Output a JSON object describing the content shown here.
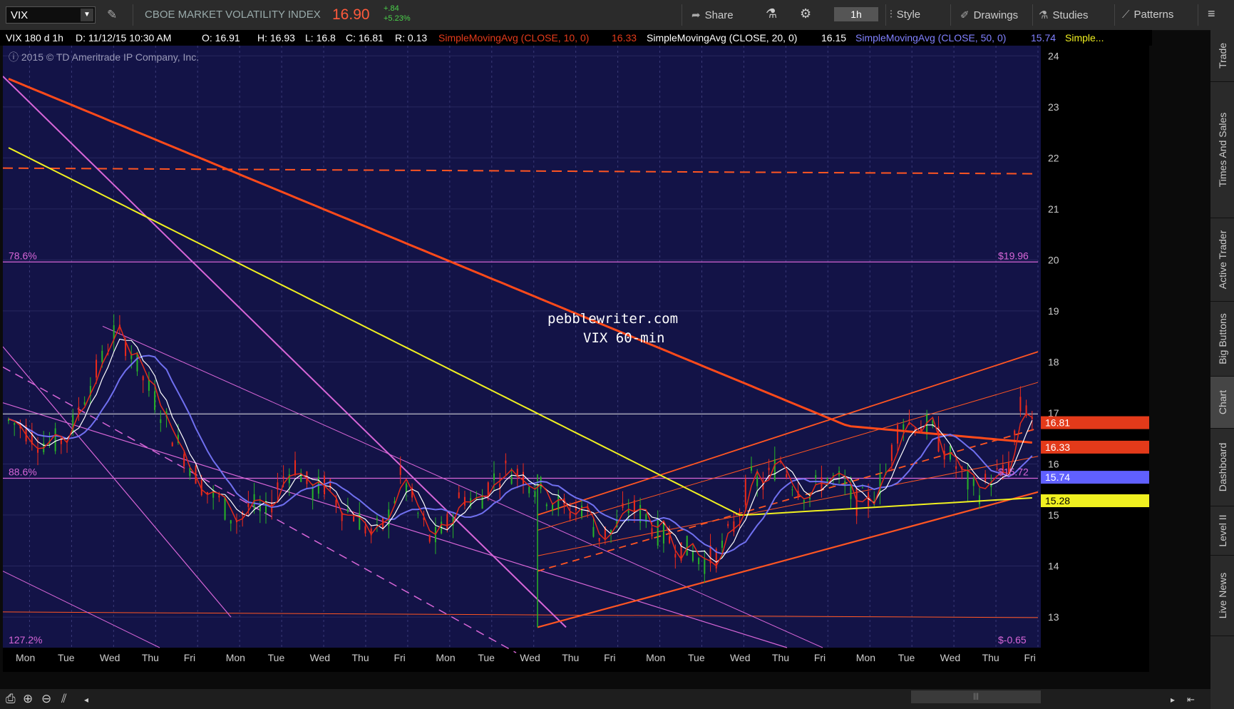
{
  "toolbar": {
    "symbol": "VIX",
    "description": "CBOE MARKET VOLATILITY INDEX",
    "last_price": "16.90",
    "change_abs": "+.84",
    "change_pct": "+5.23%",
    "timeframe": "1h",
    "buttons": {
      "share": "Share",
      "style": "Style",
      "drawings": "Drawings",
      "studies": "Studies",
      "patterns": "Patterns"
    },
    "icons": [
      "pencil-icon",
      "share-icon",
      "flask-icon",
      "gear-icon",
      "chart-style-icon",
      "drawing-icon",
      "studies-icon",
      "patterns-icon",
      "menu-icon"
    ]
  },
  "infobar": {
    "desc": "VIX 180 d 1h",
    "date": "D: 11/12/15 10:30 AM",
    "open": "O: 16.91",
    "high": "H: 16.93",
    "low": "L: 16.8",
    "close": "C: 16.81",
    "range": "R: 0.13",
    "sma10": "SimpleMovingAvg (CLOSE, 10, 0)",
    "sma10_val": "16.33",
    "sma20": "SimpleMovingAvg (CLOSE, 20, 0)",
    "sma20_val": "16.15",
    "sma50": "SimpleMovingAvg (CLOSE, 50, 0)",
    "sma50_val": "15.74",
    "more": "Simple..."
  },
  "copyright": "2015 © TD Ameritrade IP Company, Inc.",
  "watermark": {
    "line1": "pebblewriter.com",
    "line2": "VIX 60-min"
  },
  "fib_labels": {
    "top_left": "78.6%",
    "top_right": "$19.96",
    "mid_left": "88.6%",
    "mid_right": "$15.72",
    "bottom_left": "127.2%",
    "bottom_right": "$-0.65"
  },
  "price_tags": [
    {
      "label": "16.81",
      "color": "#e33a1a"
    },
    {
      "label": "16.33",
      "color": "#e33a1a"
    },
    {
      "label": "15.74",
      "color": "#6060ff"
    },
    {
      "label": "15.28",
      "color": "#f0f020"
    }
  ],
  "right_tabs": [
    "Trade",
    "Times And Sales",
    "Active Trader",
    "Big Buttons",
    "Chart",
    "Dashboard",
    "Level II",
    "Live News"
  ],
  "active_tab": "Chart",
  "bottom_icons": [
    "screenshot-icon",
    "zoom-in-icon",
    "zoom-out-icon",
    "drawing-tool-icon"
  ],
  "colors": {
    "bg": "#131347",
    "candle_up": "#27b427",
    "candle_down": "#ee2a1a",
    "sma10": "#e32a1a",
    "sma20": "#ffffff",
    "sma50": "#7070f0",
    "sma100": "#f0f020",
    "sma200": "#ff4a1a",
    "channel": "#ff5522",
    "fib": "#d866d8"
  },
  "chart_data": {
    "type": "candlestick",
    "title": "VIX 60-min",
    "symbol": "VIX",
    "interval": "1h",
    "ylim": [
      12.4,
      24.2
    ],
    "y_ticks": [
      13,
      14,
      15,
      16,
      17,
      18,
      19,
      20,
      21,
      22,
      23,
      24
    ],
    "x_labels": [
      "Mon",
      "Tue",
      "Wed",
      "Thu",
      "Fri",
      "Mon",
      "Tue",
      "Wed",
      "Thu",
      "Fri",
      "Mon",
      "Tue",
      "Wed",
      "Thu",
      "Fri",
      "Mon",
      "Tue",
      "Wed",
      "Thu",
      "Fri",
      "Mon",
      "Tue",
      "Wed",
      "Thu",
      "Fri"
    ],
    "close_path": [
      16.85,
      16.72,
      16.45,
      16.42,
      16.55,
      17.35,
      17.9,
      18.6,
      18.3,
      17.6,
      17.1,
      16.5,
      16.0,
      15.5,
      15.25,
      14.9,
      15.2,
      15.0,
      15.7,
      16.0,
      15.45,
      15.6,
      15.15,
      15.0,
      14.6,
      14.85,
      15.8,
      15.05,
      14.45,
      14.8,
      15.4,
      15.25,
      15.7,
      15.9,
      15.8,
      15.55,
      15.3,
      15.05,
      15.2,
      14.6,
      14.7,
      15.15,
      15.0,
      14.65,
      14.45,
      14.3,
      14.1,
      14.25,
      14.8,
      15.7,
      15.6,
      16.1,
      15.6,
      15.4,
      15.75,
      15.65,
      15.25,
      15.3,
      15.8,
      16.9,
      16.8,
      16.7,
      16.25,
      15.8,
      15.4,
      15.75,
      15.8,
      17.2,
      16.81
    ],
    "bar_count": 880,
    "last": {
      "date": "11/12/15 10:30 AM",
      "open": 16.91,
      "high": 16.93,
      "low": 16.8,
      "close": 16.81,
      "range": 0.13
    },
    "series": [
      {
        "name": "SimpleMovingAvg (CLOSE, 10, 0)",
        "last": 16.33
      },
      {
        "name": "SimpleMovingAvg (CLOSE, 20, 0)",
        "last": 16.15
      },
      {
        "name": "SimpleMovingAvg (CLOSE, 50, 0)",
        "last": 15.74
      },
      {
        "last": 15.28
      }
    ],
    "fib_levels": [
      {
        "pct": "78.6%",
        "price": 19.96
      },
      {
        "pct": "88.6%",
        "price": 15.72
      },
      {
        "pct": "127.2%",
        "price": -0.65
      }
    ],
    "hlines": [
      {
        "price": 16.98
      },
      {
        "price": 21.8
      },
      {
        "price": 13.1
      }
    ]
  }
}
